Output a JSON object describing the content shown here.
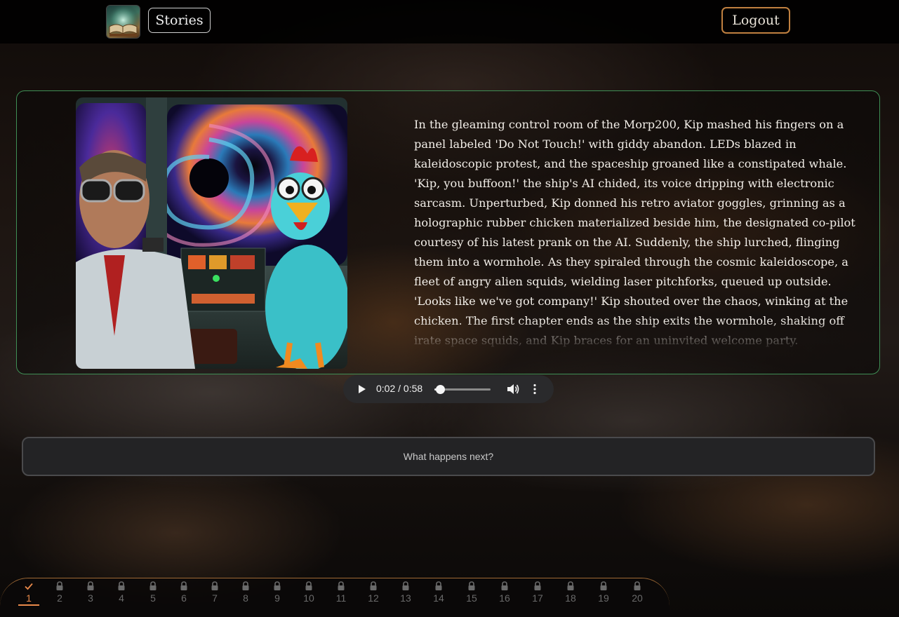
{
  "header": {
    "logo_icon": "open-book-icon",
    "stories_label": "Stories",
    "logout_label": "Logout"
  },
  "story": {
    "image_description_icon": "story-illustration",
    "text": "In the gleaming control room of the Morp200, Kip mashed his fingers on a panel labeled 'Do Not Touch!' with giddy abandon. LEDs blazed in kaleidoscopic protest, and the spaceship groaned like a constipated whale. 'Kip, you buffoon!' the ship's AI chided, its voice dripping with electronic sarcasm. Unperturbed, Kip donned his retro aviator goggles, grinning as a holographic rubber chicken materialized beside him, the designated co-pilot courtesy of his latest prank on the AI. Suddenly, the ship lurched, flinging them into a wormhole. As they spiraled through the cosmic kaleidoscope, a fleet of angry alien squids, wielding laser pitchforks, queued up outside. 'Looks like we've got company!' Kip shouted over the chaos, winking at the chicken. The first chapter ends as the ship exits the wormhole, shaking off irate space squids, and Kip braces for an uninvited welcome party."
  },
  "audio": {
    "current_time": "0:02",
    "duration": "0:58",
    "time_label": "0:02 / 0:58",
    "progress": 0.034,
    "play_icon": "play-icon",
    "volume_icon": "volume-icon",
    "more_icon": "more-vertical-icon"
  },
  "next_prompt": {
    "placeholder": "What happens next?",
    "value": ""
  },
  "chapters": {
    "active": 1,
    "items": [
      {
        "label": "1",
        "icon": "check-icon",
        "state": "completed"
      },
      {
        "label": "2",
        "icon": "lock-icon",
        "state": "locked"
      },
      {
        "label": "3",
        "icon": "lock-icon",
        "state": "locked"
      },
      {
        "label": "4",
        "icon": "lock-icon",
        "state": "locked"
      },
      {
        "label": "5",
        "icon": "lock-icon",
        "state": "locked"
      },
      {
        "label": "6",
        "icon": "lock-icon",
        "state": "locked"
      },
      {
        "label": "7",
        "icon": "lock-icon",
        "state": "locked"
      },
      {
        "label": "8",
        "icon": "lock-icon",
        "state": "locked"
      },
      {
        "label": "9",
        "icon": "lock-icon",
        "state": "locked"
      },
      {
        "label": "10",
        "icon": "lock-icon",
        "state": "locked"
      },
      {
        "label": "11",
        "icon": "lock-icon",
        "state": "locked"
      },
      {
        "label": "12",
        "icon": "lock-icon",
        "state": "locked"
      },
      {
        "label": "13",
        "icon": "lock-icon",
        "state": "locked"
      },
      {
        "label": "14",
        "icon": "lock-icon",
        "state": "locked"
      },
      {
        "label": "15",
        "icon": "lock-icon",
        "state": "locked"
      },
      {
        "label": "16",
        "icon": "lock-icon",
        "state": "locked"
      },
      {
        "label": "17",
        "icon": "lock-icon",
        "state": "locked"
      },
      {
        "label": "18",
        "icon": "lock-icon",
        "state": "locked"
      },
      {
        "label": "19",
        "icon": "lock-icon",
        "state": "locked"
      },
      {
        "label": "20",
        "icon": "lock-icon",
        "state": "locked"
      }
    ]
  },
  "colors": {
    "accent_orange": "#e8894a",
    "card_border_green": "#3f8f55",
    "logout_border": "#c08040",
    "locked_gray": "#6a6a6a"
  }
}
